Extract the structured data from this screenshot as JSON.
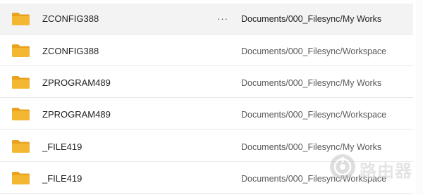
{
  "colors": {
    "folder_body": "#F4B731",
    "folder_tab": "#E8A21F",
    "selected_row": "#F3F3F3",
    "divider": "#E9E9E9"
  },
  "files": [
    {
      "name": "ZCONFIG388",
      "path": "Documents/000_Filesync/My Works",
      "icon": "folder-icon",
      "selected": true,
      "more_label": "···"
    },
    {
      "name": "ZCONFIG388",
      "path": "Documents/000_Filesync/Workspace",
      "icon": "folder-icon"
    },
    {
      "name": "ZPROGRAM489",
      "path": "Documents/000_Filesync/My Works",
      "icon": "folder-icon"
    },
    {
      "name": "ZPROGRAM489",
      "path": "Documents/000_Filesync/Workspace",
      "icon": "folder-icon"
    },
    {
      "name": "_FILE419",
      "path": "Documents/000_Filesync/My Works",
      "icon": "folder-icon"
    },
    {
      "name": "_FILE419",
      "path": "Documents/000_Filesync/Workspace",
      "icon": "folder-icon"
    }
  ],
  "watermark": {
    "text": "路由器"
  }
}
